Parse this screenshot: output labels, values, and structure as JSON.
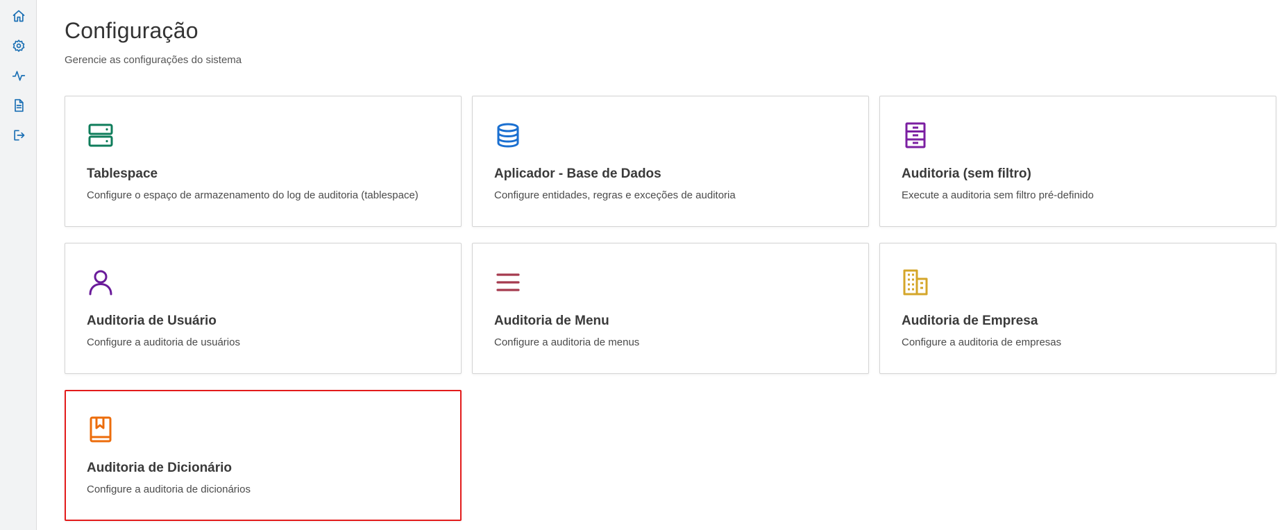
{
  "sidebar": {
    "items": [
      {
        "icon": "home-icon",
        "name": "nav-home"
      },
      {
        "icon": "gear-icon",
        "name": "nav-settings"
      },
      {
        "icon": "activity-icon",
        "name": "nav-activity"
      },
      {
        "icon": "document-icon",
        "name": "nav-documents"
      },
      {
        "icon": "logout-icon",
        "name": "nav-logout"
      }
    ],
    "icon_color": "#1a6fb4"
  },
  "header": {
    "title": "Configuração",
    "subtitle": "Gerencie as configurações do sistema"
  },
  "cards": [
    {
      "title": "Tablespace",
      "description": "Configure o espaço de armazenamento do log de auditoria (tablespace)",
      "icon": "server-icon",
      "color": "#0f7d5b"
    },
    {
      "title": "Aplicador - Base de Dados",
      "description": "Configure entidades, regras e exceções de auditoria",
      "icon": "database-icon",
      "color": "#1a6fd0"
    },
    {
      "title": "Auditoria (sem filtro)",
      "description": "Execute a auditoria sem filtro pré-definido",
      "icon": "file-cabinet-icon",
      "color": "#7b1fa2"
    },
    {
      "title": "Auditoria de Usuário",
      "description": "Configure a auditoria de usuários",
      "icon": "user-icon",
      "color": "#6a1b9a"
    },
    {
      "title": "Auditoria de Menu",
      "description": "Configure a auditoria de menus",
      "icon": "menu-icon",
      "color": "#a53a4e"
    },
    {
      "title": "Auditoria de Empresa",
      "description": "Configure a auditoria de empresas",
      "icon": "building-icon",
      "color": "#d4a62a"
    },
    {
      "title": "Auditoria de Dicionário",
      "description": "Configure a auditoria de dicionários",
      "icon": "book-icon",
      "color": "#ec6c0b",
      "selected": true
    }
  ],
  "selection_color": "#e31b1b"
}
